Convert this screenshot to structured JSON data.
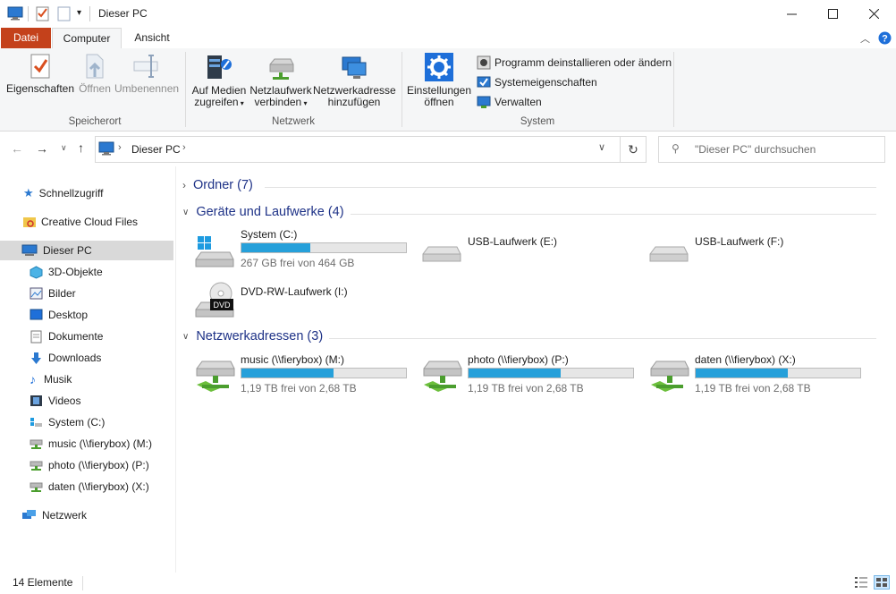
{
  "window": {
    "title": "Dieser PC"
  },
  "tabs": [
    {
      "label": "Datei"
    },
    {
      "label": "Computer"
    },
    {
      "label": "Ansicht"
    }
  ],
  "ribbon": {
    "location": {
      "label": "Speicherort",
      "buttons": [
        {
          "label1": "Eigenschaften",
          "label2": ""
        },
        {
          "label1": "Öffnen",
          "label2": ""
        },
        {
          "label1": "Umbenennen",
          "label2": ""
        }
      ]
    },
    "network": {
      "label": "Netzwerk",
      "buttons": [
        {
          "label1": "Auf Medien",
          "label2": "zugreifen"
        },
        {
          "label1": "Netzlaufwerk",
          "label2": "verbinden"
        },
        {
          "label1": "Netzwerkadresse",
          "label2": "hinzufügen"
        }
      ]
    },
    "system": {
      "label": "System",
      "settings": {
        "label1": "Einstellungen",
        "label2": "öffnen"
      },
      "small": [
        {
          "label": "Programm deinstallieren oder ändern"
        },
        {
          "label": "Systemeigenschaften"
        },
        {
          "label": "Verwalten"
        }
      ]
    }
  },
  "address": {
    "crumb": "Dieser PC"
  },
  "search": {
    "placeholder": "\"Dieser PC\" durchsuchen"
  },
  "sidebar": {
    "items": [
      {
        "label": "Schnellzugriff"
      },
      {
        "label": "Creative Cloud Files"
      },
      {
        "label": "Dieser PC"
      },
      {
        "label": "3D-Objekte"
      },
      {
        "label": "Bilder"
      },
      {
        "label": "Desktop"
      },
      {
        "label": "Dokumente"
      },
      {
        "label": "Downloads"
      },
      {
        "label": "Musik"
      },
      {
        "label": "Videos"
      },
      {
        "label": "System (C:)"
      },
      {
        "label": "music (\\\\fierybox) (M:)"
      },
      {
        "label": "photo (\\\\fierybox) (P:)"
      },
      {
        "label": "daten (\\\\fierybox) (X:)"
      },
      {
        "label": "Netzwerk"
      }
    ]
  },
  "groups": {
    "folders": {
      "title": "Ordner (7)"
    },
    "devices": {
      "title": "Geräte und Laufwerke (4)"
    },
    "network": {
      "title": "Netzwerkadressen (3)"
    }
  },
  "devices": [
    {
      "name": "System (C:)",
      "free": "267 GB frei von 464 GB",
      "used_fraction": 0.42
    },
    {
      "name": "USB-Laufwerk (E:)",
      "free": ""
    },
    {
      "name": "USB-Laufwerk (F:)",
      "free": ""
    },
    {
      "name": "DVD-RW-Laufwerk (I:)",
      "free": "",
      "badge": "DVD"
    }
  ],
  "network_drives": [
    {
      "name": "music (\\\\fierybox) (M:)",
      "free": "1,19 TB frei von 2,68 TB",
      "used_fraction": 0.56
    },
    {
      "name": "photo (\\\\fierybox) (P:)",
      "free": "1,19 TB frei von 2,68 TB",
      "used_fraction": 0.56
    },
    {
      "name": "daten (\\\\fierybox) (X:)",
      "free": "1,19 TB frei von 2,68 TB",
      "used_fraction": 0.56
    }
  ],
  "status": {
    "count": "14 Elemente"
  },
  "colors": {
    "accent": "#26a0da",
    "file_tab": "#c4411b",
    "group_head": "#1e3287",
    "selection": "#d9d9d9"
  }
}
